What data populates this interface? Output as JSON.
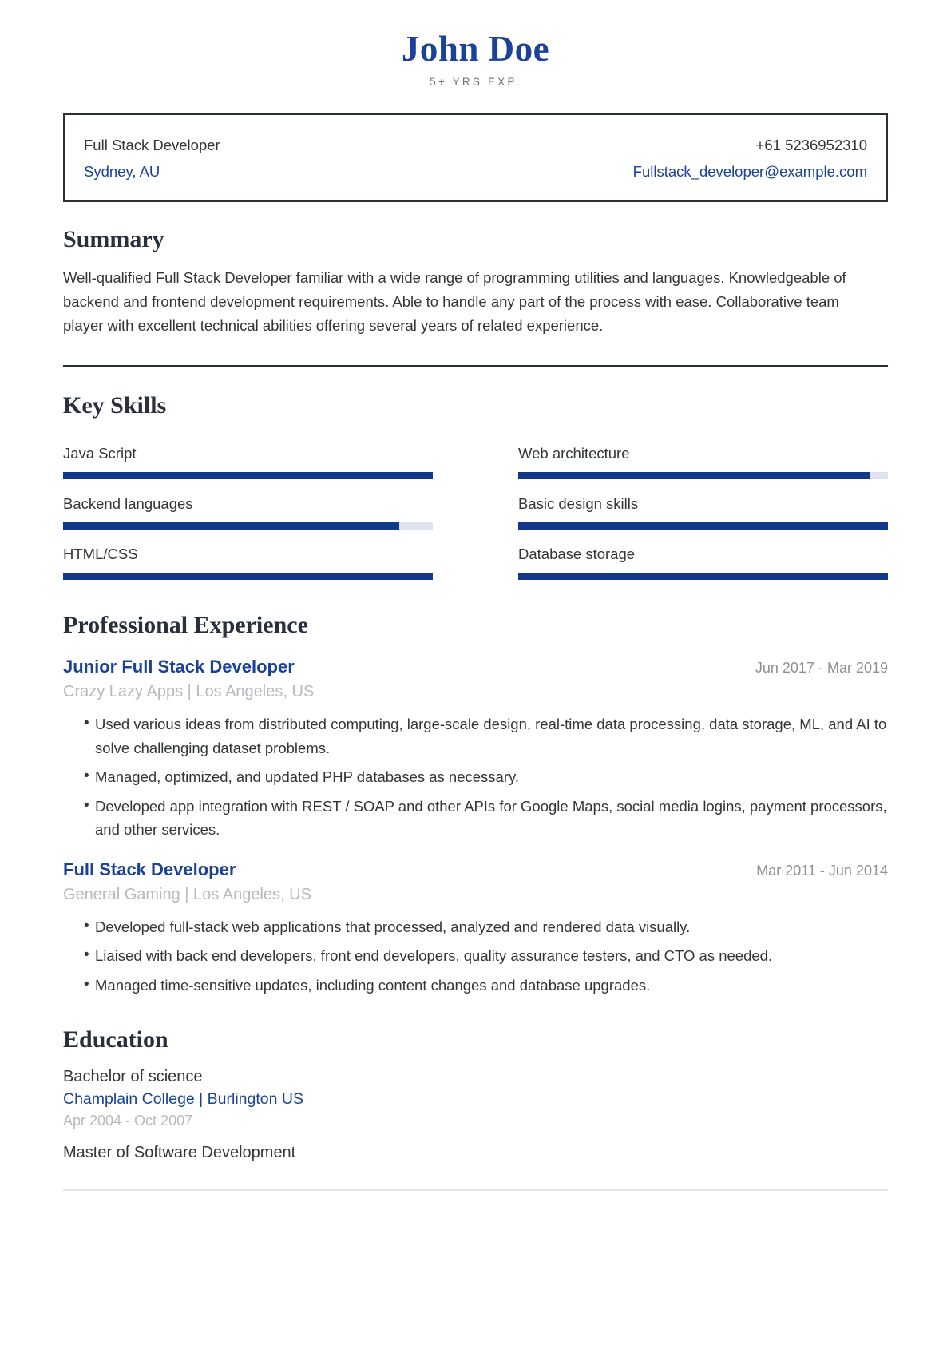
{
  "header": {
    "name": "John Doe",
    "tagline": "5+ YRS EXP."
  },
  "contact": {
    "job_title": "Full Stack Developer",
    "location": "Sydney, AU",
    "phone": "+61 5236952310",
    "email": "Fullstack_developer@example.com"
  },
  "summary": {
    "title": "Summary",
    "text": "Well-qualified Full Stack Developer familiar with a wide range of programming utilities and languages. Knowledgeable of backend and frontend development requirements. Able to handle any part of the process with ease. Collaborative team player with excellent technical abilities offering several years of related experience."
  },
  "skills": {
    "title": "Key Skills",
    "items": [
      {
        "label": "Java Script",
        "level": 100
      },
      {
        "label": "Web architecture",
        "level": 95
      },
      {
        "label": "Backend languages",
        "level": 91
      },
      {
        "label": "Basic design skills",
        "level": 100
      },
      {
        "label": "HTML/CSS",
        "level": 100
      },
      {
        "label": "Database storage",
        "level": 100
      }
    ]
  },
  "experience": {
    "title": "Professional Experience",
    "jobs": [
      {
        "title": "Junior Full Stack Developer",
        "dates": "Jun 2017 - Mar 2019",
        "company": "Crazy Lazy Apps | Los Angeles, US",
        "bullets": [
          "Used various ideas from distributed computing, large-scale design, real-time data processing, data storage, ML, and AI to solve challenging dataset problems.",
          "Managed, optimized, and updated PHP databases as necessary.",
          "Developed app integration with REST / SOAP and other APIs for Google Maps, social media logins, payment processors, and other services."
        ]
      },
      {
        "title": "Full Stack Developer",
        "dates": "Mar 2011 - Jun 2014",
        "company": "General Gaming | Los Angeles, US",
        "bullets": [
          "Developed full-stack web applications that processed, analyzed and rendered data visually.",
          "Liaised with back end developers, front end developers, quality assurance testers, and CTO as needed.",
          "Managed time-sensitive updates, including content changes and database upgrades."
        ]
      }
    ]
  },
  "education": {
    "title": "Education",
    "items": [
      {
        "degree": "Bachelor of science",
        "school": "Champlain College | Burlington US",
        "dates": "Apr 2004 - Oct 2007"
      },
      {
        "degree": "Master of Software Development",
        "school": "",
        "dates": ""
      }
    ]
  },
  "colors": {
    "accent_blue": "#1b4297",
    "bar_fill": "#12388a",
    "bar_track": "#dfe3ef",
    "heading_navy": "#2a2f3d",
    "muted_gray": "#b6b9bd"
  }
}
